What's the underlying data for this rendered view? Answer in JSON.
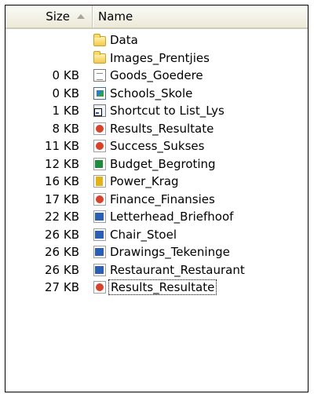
{
  "header": {
    "size_label": "Size",
    "name_label": "Name"
  },
  "files": [
    {
      "size": "",
      "name": "Data",
      "icon": "folder-icon"
    },
    {
      "size": "",
      "name": "Images_Prentjies",
      "icon": "folder-icon"
    },
    {
      "size": "0 KB",
      "name": "Goods_Goedere",
      "icon": "text-document-icon"
    },
    {
      "size": "0 KB",
      "name": "Schools_Skole",
      "icon": "bitmap-image-icon"
    },
    {
      "size": "1 KB",
      "name": "Shortcut to List_Lys",
      "icon": "shortcut-icon"
    },
    {
      "size": "8 KB",
      "name": "Results_Resultate",
      "icon": "powerpoint-icon"
    },
    {
      "size": "11 KB",
      "name": "Success_Sukses",
      "icon": "powerpoint-icon"
    },
    {
      "size": "12 KB",
      "name": "Budget_Begroting",
      "icon": "excel-icon"
    },
    {
      "size": "16 KB",
      "name": "Power_Krag",
      "icon": "publisher-icon"
    },
    {
      "size": "17 KB",
      "name": "Finance_Finansies",
      "icon": "powerpoint-icon"
    },
    {
      "size": "22 KB",
      "name": "Letterhead_Briefhoof",
      "icon": "word-icon"
    },
    {
      "size": "26 KB",
      "name": "Chair_Stoel",
      "icon": "word-icon"
    },
    {
      "size": "26 KB",
      "name": "Drawings_Tekeninge",
      "icon": "word-icon"
    },
    {
      "size": "26 KB",
      "name": "Restaurant_Restaurant",
      "icon": "word-icon"
    },
    {
      "size": "27 KB",
      "name": "Results_Resultate",
      "icon": "powerpoint-icon"
    }
  ],
  "colors": {
    "header_bg": "#ece9d8",
    "folder": "#f2c94c",
    "word": "#2b5fb4",
    "excel": "#1e8c3a",
    "powerpoint": "#d9412b"
  }
}
